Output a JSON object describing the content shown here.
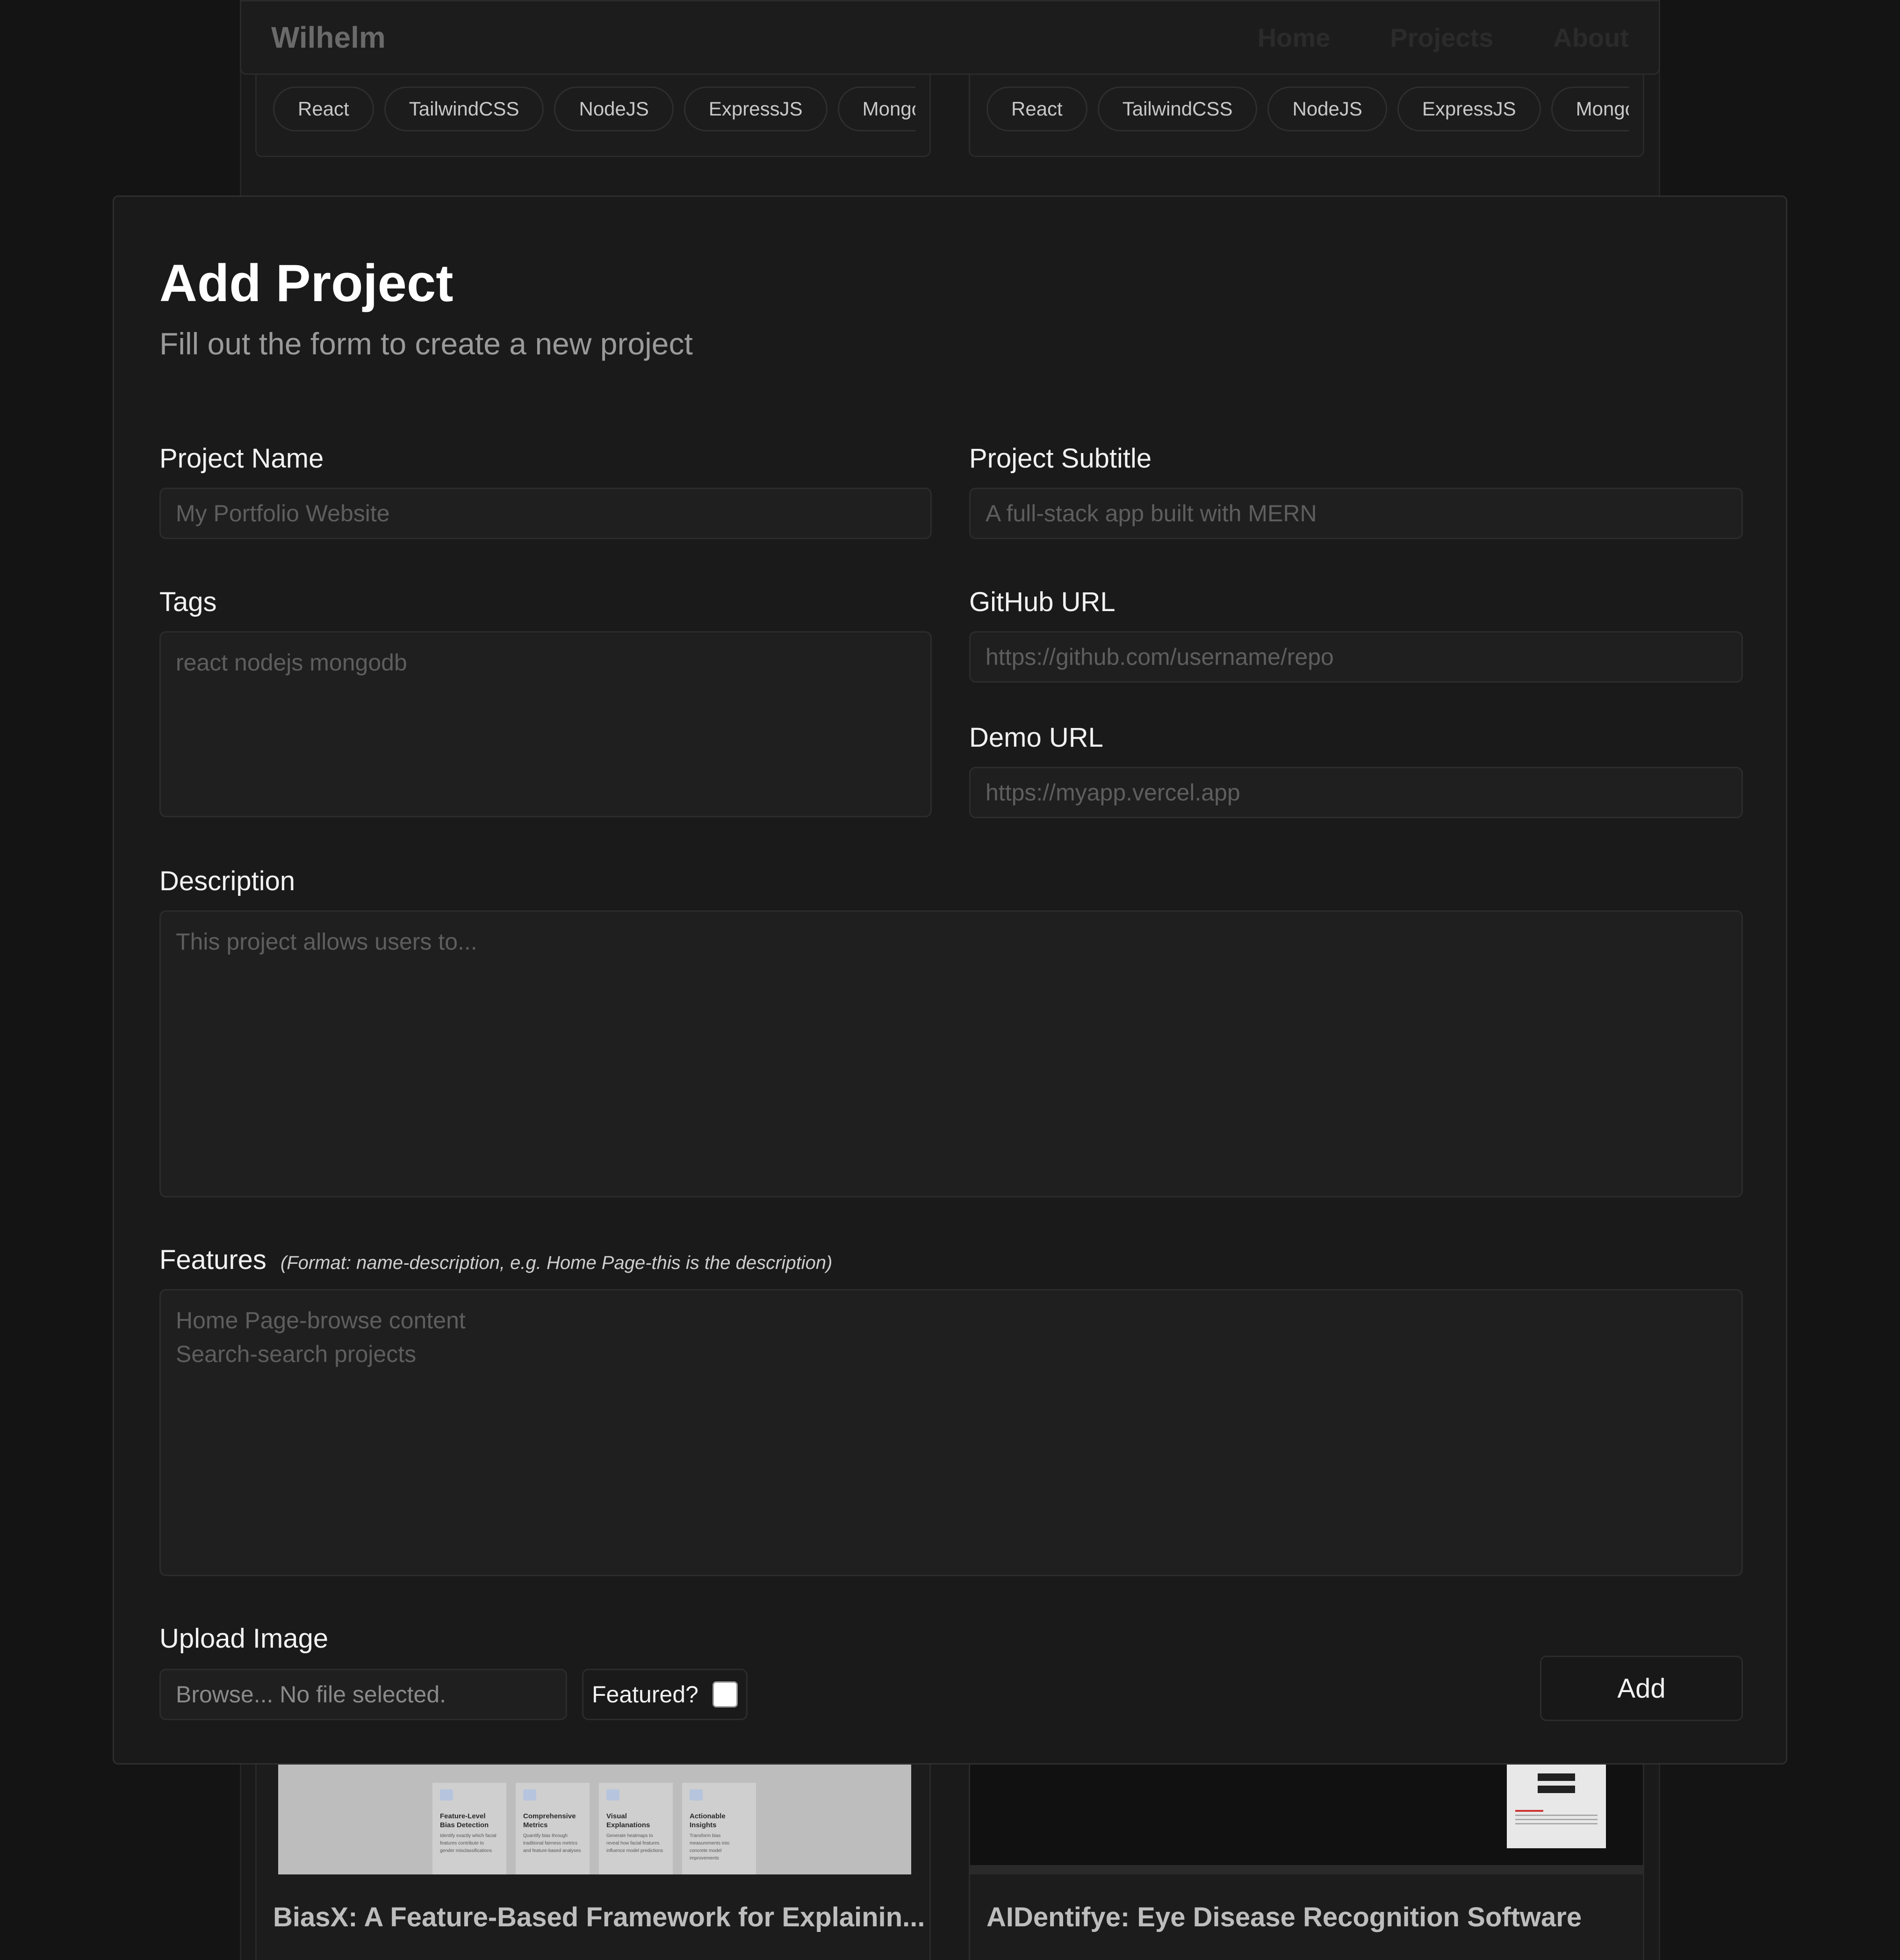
{
  "navbar": {
    "brand": "Wilhelm",
    "links": [
      "Home",
      "Projects",
      "About"
    ]
  },
  "background_cards": {
    "top_left_tags": [
      "React",
      "TailwindCSS",
      "NodeJS",
      "ExpressJS",
      "MongoD"
    ],
    "top_right_tags": [
      "React",
      "TailwindCSS",
      "NodeJS",
      "ExpressJS",
      "MongoD"
    ],
    "bottom_left": {
      "title": "BiasX: A Feature-Based Framework for Explainin...",
      "thumbnail_features": [
        {
          "title": "Feature-Level Bias Detection",
          "text": "Identify exactly which facial features contribute to gender misclassifications"
        },
        {
          "title": "Comprehensive Metrics",
          "text": "Quantify bias through traditional fairness metrics and feature-based analyses"
        },
        {
          "title": "Visual Explanations",
          "text": "Generate heatmaps to reveal how facial features influence model predictions"
        },
        {
          "title": "Actionable Insights",
          "text": "Transform bias measurements into concrete model improvements"
        }
      ]
    },
    "bottom_right": {
      "title": "AIDentifye: Eye Disease Recognition Software"
    }
  },
  "modal": {
    "title": "Add Project",
    "subtitle": "Fill out the form to create a new project",
    "fields": {
      "project_name": {
        "label": "Project Name",
        "placeholder": "My Portfolio Website",
        "value": ""
      },
      "project_subtitle": {
        "label": "Project Subtitle",
        "placeholder": "A full-stack app built with MERN",
        "value": ""
      },
      "tags": {
        "label": "Tags",
        "placeholder": "react nodejs mongodb",
        "value": ""
      },
      "github_url": {
        "label": "GitHub URL",
        "placeholder": "https://github.com/username/repo",
        "value": ""
      },
      "demo_url": {
        "label": "Demo URL",
        "placeholder": "https://myapp.vercel.app",
        "value": ""
      },
      "description": {
        "label": "Description",
        "placeholder": "This project allows users to...",
        "value": ""
      },
      "features": {
        "label": "Features",
        "hint": "(Format: name-description, e.g. Home Page-this is the description)",
        "placeholder": "Home Page-browse content\nSearch-search projects",
        "value": ""
      },
      "upload_image": {
        "label": "Upload Image",
        "button_text": "Browse... No file selected."
      },
      "featured": {
        "label": "Featured?",
        "checked": false
      }
    },
    "submit_label": "Add"
  }
}
